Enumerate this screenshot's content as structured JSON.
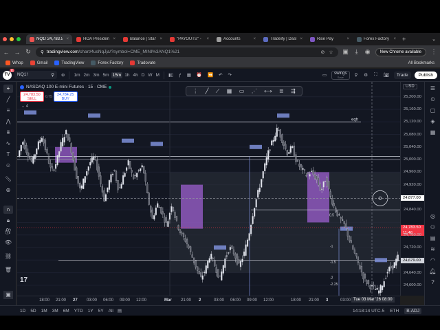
{
  "browser": {
    "tabs": [
      {
        "label": "NQ1! 24,783.5…",
        "color": "#ef5350",
        "active": true
      },
      {
        "label": "HOA President…",
        "color": "#e53935"
      },
      {
        "label": "Balance | Stand…",
        "color": "#e53935"
      },
      {
        "label": "\"PAYOUTS\" - …",
        "color": "#e53935"
      },
      {
        "label": "Accounts",
        "color": "#9e9e9e"
      },
      {
        "label": "Tradeify | Dash…",
        "color": "#5c6bc0"
      },
      {
        "label": "Rise Pay",
        "color": "#7e57c2"
      },
      {
        "label": "Forex Factory",
        "color": "#455a64"
      }
    ],
    "new_tab": "+",
    "address": {
      "host": "tradingview.com",
      "path": "/chart/4usNqJja/?symbol=CME_MINI%3ANQ1%21"
    },
    "new_chrome_label": "New Chrome available",
    "bookmarks": [
      {
        "label": "Whop",
        "color": "#ff5722"
      },
      {
        "label": "Gmail",
        "color": "#ea4335"
      },
      {
        "label": "TradingView",
        "color": "#2962ff"
      },
      {
        "label": "Forex Factory",
        "color": "#455a64"
      },
      {
        "label": "Tradovate",
        "color": "#e53935"
      }
    ],
    "all_bookmarks": "All Bookmarks"
  },
  "tv": {
    "logo_badge": "11",
    "symbol": "NQ1!",
    "intervals": [
      "1m",
      "2m",
      "3m",
      "5m",
      "15m",
      "1h",
      "4h",
      "D",
      "W",
      "M"
    ],
    "active_interval": "15m",
    "swings_label": "swings",
    "swings_sub": "Save",
    "trade_label": "Trade",
    "publish_label": "Publish",
    "legend_title": "NASDAQ 100 E-mini Futures · 15 · CME",
    "sell_price": "24,783.50",
    "sell_label": "SELL",
    "buy_price": "24,784.25",
    "buy_label": "BUY",
    "spread": "0.75",
    "collapse": "4",
    "currency": "USD",
    "eqh_label": "eqh",
    "price_labels": [
      "25,200.00",
      "25,160.00",
      "25,120.00",
      "25,080.00",
      "25,040.00",
      "25,000.00",
      "24,960.00",
      "24,920.00",
      "24,877.00",
      "24,840.00",
      "24,783.50",
      "11:46",
      "24,760.00",
      "24,720.00",
      "24,679.00",
      "24,640.00",
      "24,600.00"
    ],
    "time_labels": [
      "18:00",
      "21:00",
      "27",
      "03:00",
      "06:00",
      "09:00",
      "12:00",
      "Mar",
      "21:00",
      "2",
      "03:00",
      "06:00",
      "09:00",
      "12:00",
      "18:00",
      "21:00",
      "3",
      "03:00",
      "06:00"
    ],
    "time_cursor": "Tue 03 Mar '26  08:00",
    "fib_labels": [
      "1",
      "0.5",
      "-1",
      "-1.5",
      "-2",
      "-2.25"
    ],
    "ranges": [
      "1D",
      "5D",
      "1M",
      "3M",
      "6M",
      "YTD",
      "1Y",
      "5Y",
      "All"
    ],
    "clock": "14:18:14 UTC-5",
    "eth": "ETH",
    "badj": "B-ADJ"
  },
  "chart_data": {
    "type": "candlestick",
    "title": "NASDAQ 100 E-mini Futures · 15 · CME",
    "ylim": [
      24580,
      25230
    ],
    "x_ticks": [
      "18:00",
      "21:00",
      "27",
      "03:00",
      "06:00",
      "09:00",
      "12:00",
      "Mar",
      "21:00",
      "2",
      "03:00",
      "06:00",
      "09:00",
      "12:00",
      "18:00",
      "21:00",
      "3",
      "03:00",
      "06:00"
    ],
    "close_path": [
      25010,
      25060,
      25020,
      24990,
      25040,
      25075,
      25020,
      24960,
      24990,
      25050,
      25090,
      25040,
      24960,
      24900,
      24950,
      24990,
      25010,
      24940,
      24870,
      24930,
      24970,
      24900,
      24950,
      24990,
      24940,
      24960,
      24980,
      24880,
      24810,
      24860,
      24830,
      24790,
      24860,
      24800,
      24760,
      24740,
      24700,
      24660,
      24620,
      24650,
      24700,
      24660,
      24620,
      24680,
      24720,
      24700,
      24660,
      24700,
      24760,
      24840,
      24900,
      24960,
      25020,
      25060,
      25100,
      25060,
      25020,
      25040,
      24990,
      24970,
      24950,
      24960,
      24940,
      24900,
      24940,
      24880,
      24840,
      24810,
      24790,
      24740,
      24700,
      24660,
      24620,
      24600,
      24590,
      24580,
      24610,
      24650,
      24660,
      24690
    ],
    "current_price": 24783.5,
    "crosshair_price": 24877.0
  }
}
